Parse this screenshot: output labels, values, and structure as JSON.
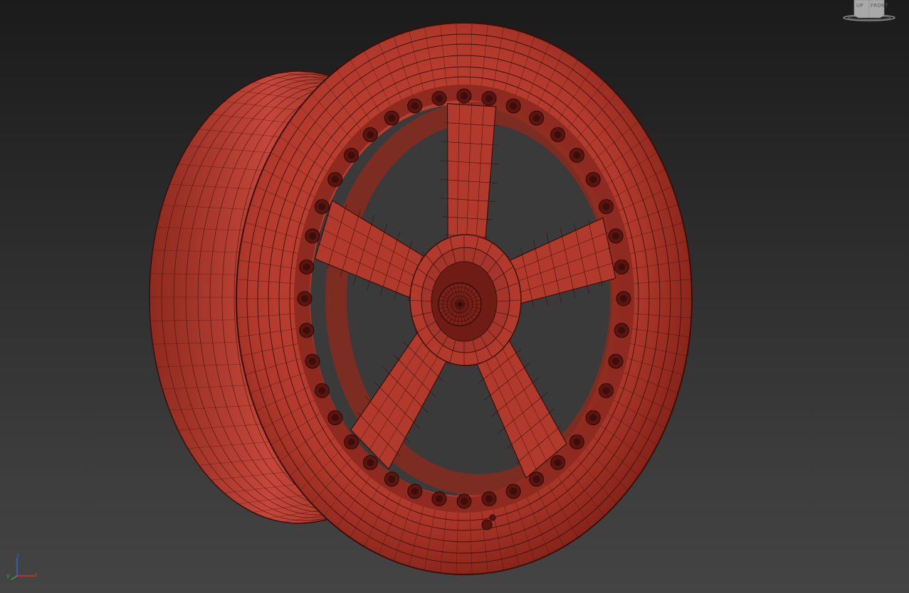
{
  "viewport": {
    "background_top": "#1b1b1b",
    "background_bottom": "#444444",
    "model": {
      "type": "wheel",
      "spokes": 5,
      "rim_bolts": 40,
      "color": "#b23a2c",
      "wire_color": "#3a0f0a",
      "display": "shaded-wireframe"
    }
  },
  "viewcube": {
    "face_left": "UP",
    "face_right": "FRONT",
    "icon": "viewcube-icon"
  },
  "axis_tripod": {
    "z": "z",
    "y": "y",
    "x": "x",
    "z_color": "#3a5fd0",
    "y_color": "#3aa04a",
    "x_color": "#c83a30"
  }
}
